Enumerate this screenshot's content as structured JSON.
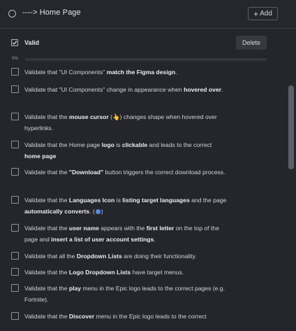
{
  "header": {
    "title": "---->  Home Page",
    "add_label": "Add"
  },
  "group": {
    "name": "Valid",
    "delete_label": "Delete",
    "progress_label": "0%",
    "progress_value": 0
  },
  "items": [
    {
      "parts": [
        [
          "Validate that \"UI Components\" ",
          false
        ],
        [
          "match the Figma design",
          true
        ],
        [
          ".",
          false
        ]
      ]
    },
    {
      "parts": [
        [
          "Validate that \"UI Components\" change in appearance when ",
          false
        ],
        [
          "hovered over",
          true
        ],
        [
          ".",
          false
        ]
      ]
    },
    {
      "parts": [
        [
          "Validate that the ",
          false
        ],
        [
          "mouse cursor",
          true
        ],
        [
          " (👆) changes shape when hovered over hyperlinks.",
          false
        ]
      ]
    },
    {
      "parts": [
        [
          "Validate that the Home page ",
          false
        ],
        [
          "logo",
          true
        ],
        [
          " is ",
          false
        ],
        [
          "clickable",
          true
        ],
        [
          " and leads to the correct ",
          false
        ],
        [
          "home page",
          true
        ]
      ]
    },
    {
      "parts": [
        [
          "Validate that the ",
          false
        ],
        [
          "\"Download\"",
          true
        ],
        [
          " button triggers the correct download process.",
          false
        ]
      ]
    },
    {
      "parts": [
        [
          "Validate that the ",
          false
        ],
        [
          "Languages Icon",
          true
        ],
        [
          " is ",
          false
        ],
        [
          "listing target languages",
          true
        ],
        [
          " and the page ",
          false
        ],
        [
          "automatically converts",
          true
        ],
        [
          ". (",
          false
        ],
        [
          "GLOBE",
          false
        ],
        [
          ")",
          false
        ]
      ]
    },
    {
      "parts": [
        [
          "Validate that the ",
          false
        ],
        [
          "user name",
          true
        ],
        [
          " appears with the ",
          false
        ],
        [
          "first letter",
          true
        ],
        [
          " on the top of the page and ",
          false
        ],
        [
          "insert a list of user account settings",
          true
        ],
        [
          ".",
          false
        ]
      ]
    },
    {
      "parts": [
        [
          "Validate that all the ",
          false
        ],
        [
          "Dropdown Lists",
          true
        ],
        [
          " are doing their functionality.",
          false
        ]
      ]
    },
    {
      "parts": [
        [
          "Validate that the ",
          false
        ],
        [
          "Logo Dropdown Lists",
          true
        ],
        [
          " have target menus.",
          false
        ]
      ]
    },
    {
      "parts": [
        [
          "Validate that the ",
          false
        ],
        [
          "play",
          true
        ],
        [
          " menu in the Epic logo leads to the correct pages (e.g. Fortnite).",
          false
        ]
      ]
    },
    {
      "parts": [
        [
          "Validate that the ",
          false
        ],
        [
          "Discover",
          true
        ],
        [
          " menu in the Epic logo leads to the correct",
          false
        ]
      ]
    }
  ],
  "colors": {
    "background": "#24262b",
    "accent": "#5b8def",
    "globe": "#4d8ef0"
  }
}
